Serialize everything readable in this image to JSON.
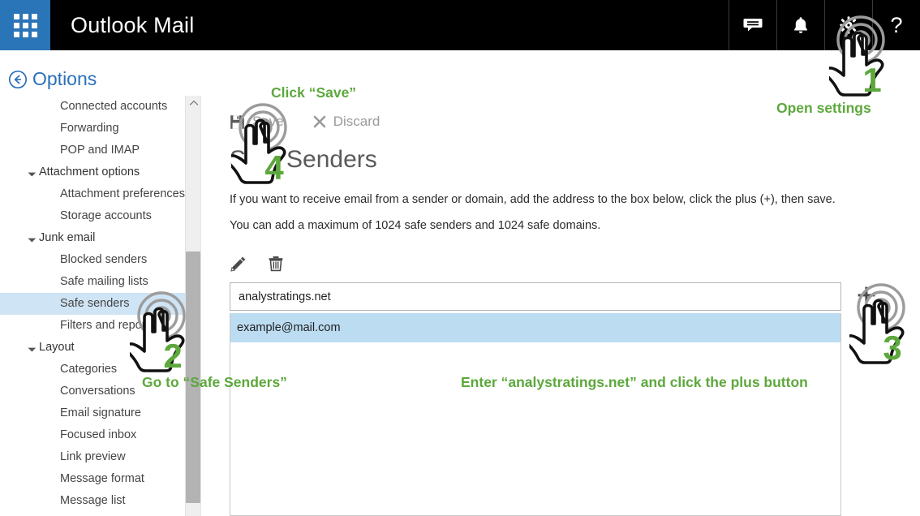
{
  "topbar": {
    "waffle_label": "app-launcher",
    "app_title": "Outlook Mail",
    "icons": [
      {
        "name": "chat-icon",
        "glyph": "chat"
      },
      {
        "name": "bell-icon",
        "glyph": "bell"
      },
      {
        "name": "gear-icon",
        "glyph": "gear"
      },
      {
        "name": "help-icon",
        "glyph": "?"
      }
    ],
    "help_glyph": "?"
  },
  "options": {
    "label": "Options"
  },
  "sidebar": {
    "items": [
      {
        "label": "Connected accounts",
        "type": "leaf",
        "selected": false
      },
      {
        "label": "Forwarding",
        "type": "leaf",
        "selected": false
      },
      {
        "label": "POP and IMAP",
        "type": "leaf",
        "selected": false
      },
      {
        "label": "Attachment options",
        "type": "group",
        "selected": false
      },
      {
        "label": "Attachment preferences",
        "type": "leaf",
        "selected": false
      },
      {
        "label": "Storage accounts",
        "type": "leaf",
        "selected": false
      },
      {
        "label": "Junk email",
        "type": "group",
        "selected": false
      },
      {
        "label": "Blocked senders",
        "type": "leaf",
        "selected": false
      },
      {
        "label": "Safe mailing lists",
        "type": "leaf",
        "selected": false
      },
      {
        "label": "Safe senders",
        "type": "leaf",
        "selected": true
      },
      {
        "label": "Filters and reporting",
        "type": "leaf",
        "selected": false
      },
      {
        "label": "Layout",
        "type": "group",
        "selected": false
      },
      {
        "label": "Categories",
        "type": "leaf",
        "selected": false
      },
      {
        "label": "Conversations",
        "type": "leaf",
        "selected": false
      },
      {
        "label": "Email signature",
        "type": "leaf",
        "selected": false
      },
      {
        "label": "Focused inbox",
        "type": "leaf",
        "selected": false
      },
      {
        "label": "Link preview",
        "type": "leaf",
        "selected": false
      },
      {
        "label": "Message format",
        "type": "leaf",
        "selected": false
      },
      {
        "label": "Message list",
        "type": "leaf",
        "selected": false
      }
    ],
    "caret_glyph": "◢"
  },
  "main": {
    "save_label": "Save",
    "discard_label": "Discard",
    "title": "Safe Senders",
    "description_line1": "If you want to receive email from a sender or domain, add the address to the box below, click the plus (+), then save.",
    "description_line2": "You can add a maximum of 1024 safe senders and 1024 safe domains.",
    "edit_icon_name": "pencil-icon",
    "delete_icon_name": "trash-icon",
    "input_value": "analystratings.net",
    "input_placeholder": "",
    "add_button_label": "+",
    "list_items": [
      {
        "value": "example@mail.com",
        "selected": true
      }
    ]
  },
  "annotations": [
    {
      "id": "step1",
      "number": "1",
      "text": "Open settings"
    },
    {
      "id": "step2",
      "number": "2",
      "text": "Go to “Safe Senders”"
    },
    {
      "id": "step3",
      "number": "3",
      "text": "Enter “analystratings.net” and click the plus button"
    },
    {
      "id": "step4",
      "number": "4",
      "text": "Click “Save”"
    }
  ],
  "annotation_text": {
    "open_settings": "Open settings",
    "click_save": "Click “Save”",
    "go_safe_senders": "Go to “Safe Senders”",
    "enter_domain": "Enter “analystratings.net” and click the plus button"
  },
  "step_numbers": {
    "one": "1",
    "two": "2",
    "three": "3",
    "four": "4"
  },
  "colors": {
    "accent_blue": "#2a74b8",
    "topbar_black": "#000000",
    "annotation_green": "#5da83c",
    "selection_blue": "#cfe4f5",
    "list_selection_blue": "#bcdcf2",
    "link_blue": "#2b70b8"
  }
}
